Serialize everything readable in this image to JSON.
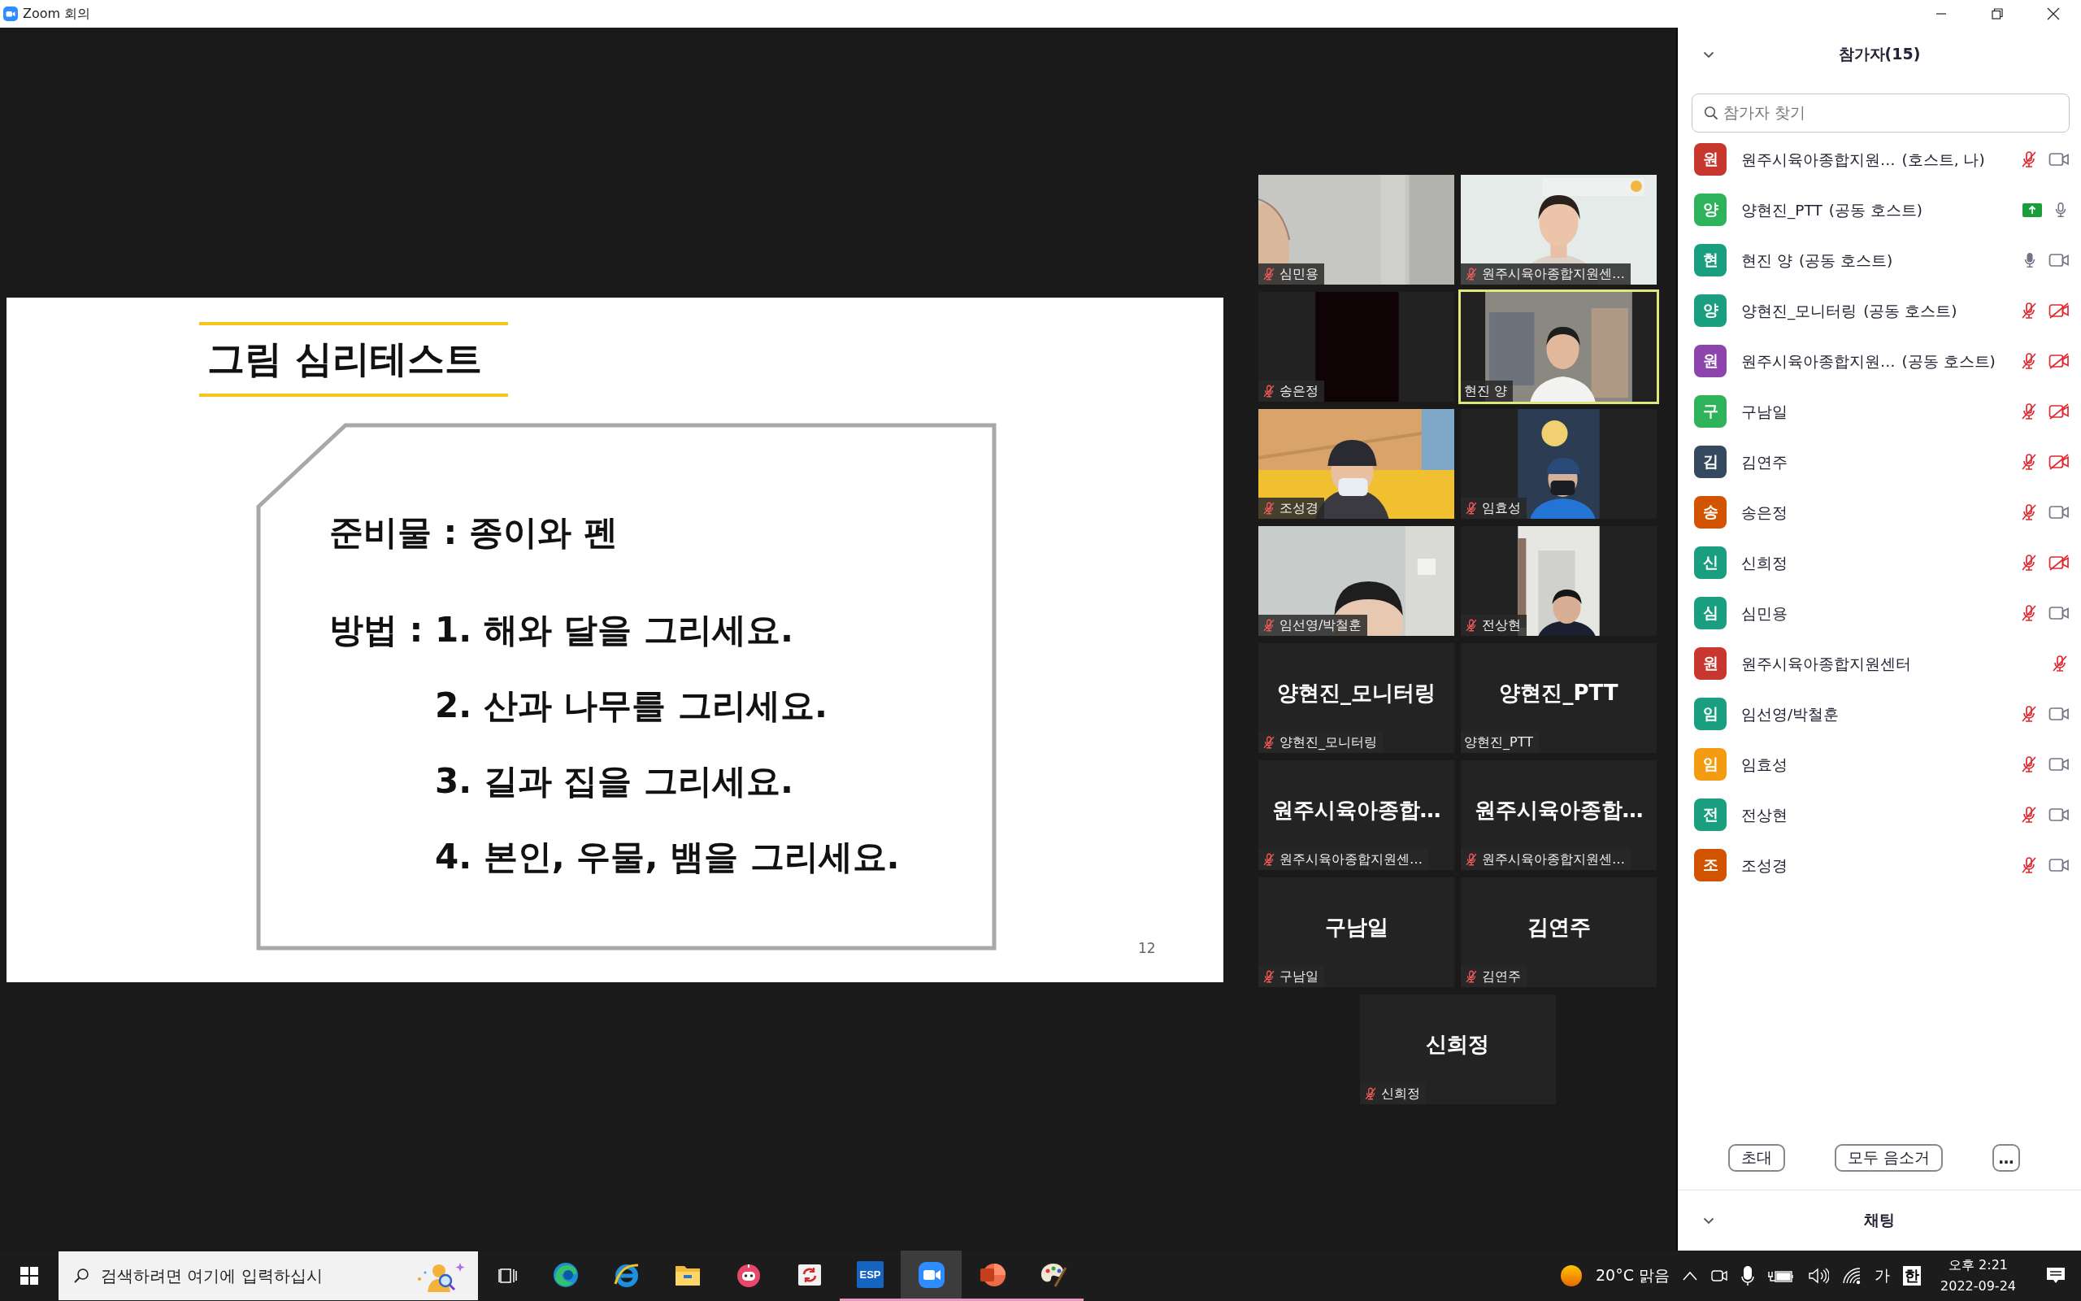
{
  "window": {
    "title": "Zoom 회의"
  },
  "slide": {
    "title": "그림 심리테스트",
    "materials": "준비물 : 종이와 펜",
    "method_label": "방법 :",
    "steps": [
      "1. 해와 달을 그리세요.",
      "2. 산과 나무를 그리세요.",
      "3. 길과 집을 그리세요.",
      "4. 본인, 우물, 뱀을 그리세요."
    ],
    "page_number": "12"
  },
  "videos": [
    {
      "kind": "video",
      "name": "심민용",
      "muted": true,
      "speaking": false
    },
    {
      "kind": "video",
      "name": "원주시육아종합지원센…",
      "muted": true,
      "speaking": false
    },
    {
      "kind": "video",
      "name": "송은정",
      "muted": true,
      "speaking": false
    },
    {
      "kind": "video",
      "name": "현진 양",
      "muted": false,
      "speaking": true
    },
    {
      "kind": "video",
      "name": "조성경",
      "muted": true,
      "speaking": false
    },
    {
      "kind": "video",
      "name": "임효성",
      "muted": true,
      "speaking": false
    },
    {
      "kind": "video",
      "name": "임선영/박철훈",
      "muted": true,
      "speaking": false
    },
    {
      "kind": "video",
      "name": "전상현",
      "muted": true,
      "speaking": false
    },
    {
      "kind": "name",
      "display_name": "양현진_모니터링",
      "name": "양현진_모니터링",
      "muted": true,
      "speaking": false
    },
    {
      "kind": "name",
      "display_name": "양현진_PTT",
      "name": "양현진_PTT",
      "muted": false,
      "speaking": false
    },
    {
      "kind": "name",
      "display_name": "원주시육아종합…",
      "name": "원주시육아종합지원센…",
      "muted": true,
      "speaking": false
    },
    {
      "kind": "name",
      "display_name": "원주시육아종합…",
      "name": "원주시육아종합지원센…",
      "muted": true,
      "speaking": false
    },
    {
      "kind": "name",
      "display_name": "구남일",
      "name": "구남일",
      "muted": true,
      "speaking": false
    },
    {
      "kind": "name",
      "display_name": "김연주",
      "name": "김연주",
      "muted": true,
      "speaking": false
    },
    {
      "kind": "name",
      "display_name": "신희정",
      "name": "신희정",
      "muted": true,
      "speaking": false
    }
  ],
  "participants": {
    "title": "참가자(15)",
    "search": {
      "placeholder": "참가자 찾기"
    },
    "items": [
      {
        "initial": "원",
        "name": "원주시육아종합지원…",
        "role": "(호스트, 나)",
        "color": "#c8372d",
        "arrow_badge": false,
        "audio": {
          "muted": true,
          "talking": false
        },
        "video": {
          "on": true
        }
      },
      {
        "initial": "양",
        "name": "양현진_PTT",
        "role": "(공동 호스트)",
        "color": "#2eb35a",
        "arrow_badge": true,
        "audio": {
          "muted": false,
          "talking": false
        }
      },
      {
        "initial": "현",
        "name": "현진 양",
        "role": "(공동 호스트)",
        "color": "#1a9e80",
        "arrow_badge": false,
        "audio": {
          "muted": false,
          "talking": true
        },
        "video": {
          "on": true
        }
      },
      {
        "initial": "양",
        "name": "양현진_모니터링",
        "role": "(공동 호스트)",
        "color": "#1a9e80",
        "arrow_badge": false,
        "audio": {
          "muted": true,
          "talking": false
        },
        "video": {
          "on": false
        }
      },
      {
        "initial": "원",
        "name": "원주시육아종합지원…",
        "role": "(공동 호스트)",
        "color": "#8e44ad",
        "arrow_badge": false,
        "audio": {
          "muted": true,
          "talking": false
        },
        "video": {
          "on": false
        }
      },
      {
        "initial": "구",
        "name": "구남일",
        "color": "#2eb35a",
        "arrow_badge": false,
        "audio": {
          "muted": true,
          "talking": false
        },
        "video": {
          "on": false
        }
      },
      {
        "initial": "김",
        "name": "김연주",
        "color": "#34495e",
        "arrow_badge": false,
        "audio": {
          "muted": true,
          "talking": false
        },
        "video": {
          "on": false
        }
      },
      {
        "initial": "송",
        "name": "송은정",
        "color": "#d35400",
        "arrow_badge": false,
        "audio": {
          "muted": true,
          "talking": false
        },
        "video": {
          "on": true
        }
      },
      {
        "initial": "신",
        "name": "신희정",
        "color": "#1a9e80",
        "arrow_badge": false,
        "audio": {
          "muted": true,
          "talking": false
        },
        "video": {
          "on": false
        }
      },
      {
        "initial": "심",
        "name": "심민용",
        "color": "#1a9e80",
        "arrow_badge": false,
        "audio": {
          "muted": true,
          "talking": false
        },
        "video": {
          "on": true
        }
      },
      {
        "initial": "원",
        "name": "원주시육아종합지원센터",
        "color": "#c8372d",
        "arrow_badge": false,
        "audio": {
          "muted": true,
          "talking": false
        }
      },
      {
        "initial": "임",
        "name": "임선영/박철훈",
        "color": "#1a9e80",
        "arrow_badge": false,
        "audio": {
          "muted": true,
          "talking": false
        },
        "video": {
          "on": true
        }
      },
      {
        "initial": "임",
        "name": "임효성",
        "color": "#f39c12",
        "arrow_badge": false,
        "audio": {
          "muted": true,
          "talking": false
        },
        "video": {
          "on": true
        }
      },
      {
        "initial": "전",
        "name": "전상현",
        "color": "#1a9e80",
        "arrow_badge": false,
        "audio": {
          "muted": true,
          "talking": false
        },
        "video": {
          "on": true
        }
      },
      {
        "initial": "조",
        "name": "조성경",
        "color": "#d35400",
        "arrow_badge": false,
        "audio": {
          "muted": true,
          "talking": false
        },
        "video": {
          "on": true
        }
      }
    ],
    "buttons": [
      "초대",
      "모두 음소거",
      "…"
    ],
    "chat_title": "채팅"
  },
  "taskbar": {
    "search": {
      "placeholder": "검색하려면 여기에 입력하십시"
    },
    "apps": [
      {
        "kind": "edge",
        "running": false,
        "selected": false
      },
      {
        "kind": "ie",
        "running": false,
        "selected": false
      },
      {
        "kind": "explorer",
        "running": false,
        "selected": false
      },
      {
        "kind": "robot",
        "running": false,
        "selected": false
      },
      {
        "kind": "sync",
        "running": false,
        "selected": false
      },
      {
        "kind": "esp",
        "label": "ESP",
        "running": true,
        "selected": false
      },
      {
        "kind": "zoom",
        "running": true,
        "selected": true
      },
      {
        "kind": "powerpoint",
        "running": true,
        "selected": false
      },
      {
        "kind": "paint",
        "running": true,
        "selected": false
      }
    ],
    "weather": "20°C 맑음",
    "ime_mode": "가",
    "ime_lang": "한",
    "time": "오후 2:21",
    "date": "2022-09-24"
  }
}
